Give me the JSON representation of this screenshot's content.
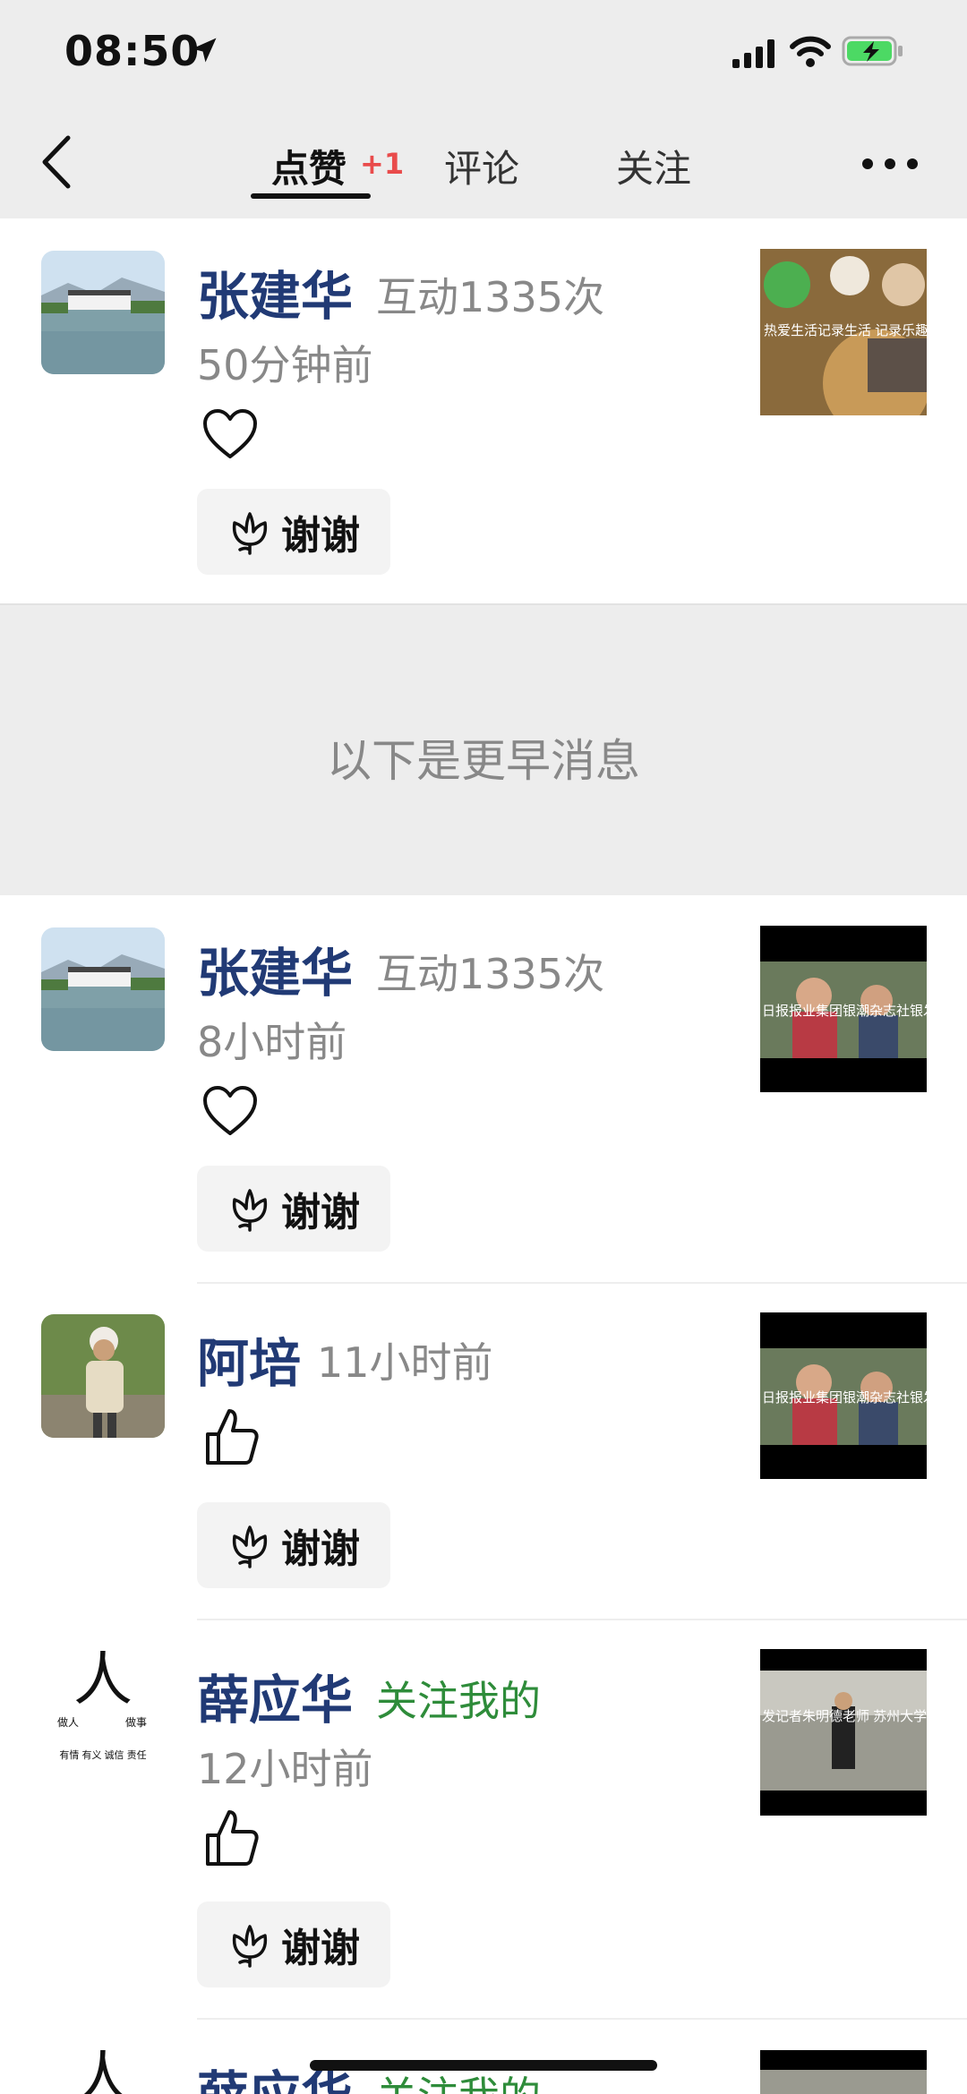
{
  "status_bar": {
    "time": "08:50"
  },
  "nav": {
    "tabs": [
      {
        "label": "点赞",
        "badge": "+1"
      },
      {
        "label": "评论"
      },
      {
        "label": "关注"
      }
    ]
  },
  "notifications_recent": [
    {
      "name": "张建华",
      "meta": "互动1335次",
      "time": "50分钟前",
      "reaction": "heart",
      "thanks_label": "谢谢"
    }
  ],
  "earlier_label": "以下是更早消息",
  "notifications_earlier": [
    {
      "name": "张建华",
      "meta": "互动1335次",
      "time": "8小时前",
      "reaction": "heart",
      "thanks_label": "谢谢"
    },
    {
      "name": "阿培",
      "time": "11小时前",
      "reaction": "thumb",
      "thanks_label": "谢谢"
    },
    {
      "name": "薛应华",
      "follow": "关注我的",
      "time": "12小时前",
      "reaction": "thumb",
      "thanks_label": "谢谢"
    },
    {
      "name": "薛应华",
      "follow": "关注我的"
    }
  ],
  "thumbnail_captions": {
    "tea": "热爱生活记录生活 记录乐趣得",
    "video1": "日报报业集团银潮杂志社银发",
    "video2": "日报报业集团银潮杂志社银发",
    "video3": "发记者朱明德老师 苏州大学"
  },
  "avatar_text": {
    "char": "人",
    "left_top": "做人",
    "right_top": "做事",
    "bottom": "有情 有义 诚信 责任"
  },
  "colors": {
    "name": "#213a75",
    "follow": "#2e8c3a",
    "badge": "#e94b4b",
    "background_gray": "#ededed"
  }
}
